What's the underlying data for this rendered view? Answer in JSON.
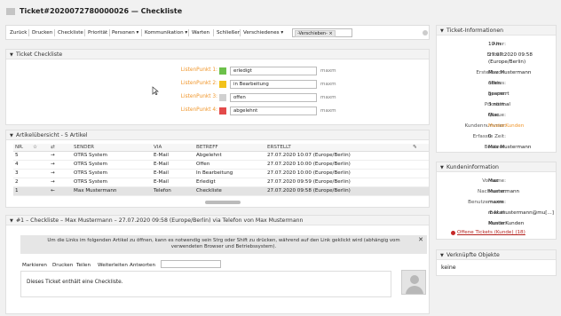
{
  "window": {
    "title": "Ticket#2020072780000026 — Checkliste"
  },
  "actions": {
    "items": [
      "Zurück",
      "Drucken",
      "Checkliste",
      "Priorität",
      "Personen ▾",
      "Kommunikation ▾",
      "Warten",
      "Schließen",
      "Verschiedenes ▾"
    ],
    "select_tag": "-Verschieben- ×"
  },
  "checklist": {
    "header": "Ticket Checkliste",
    "items": [
      {
        "label": "ListenPunkt 1:",
        "color": "#6cc04a",
        "status": "erledigt",
        "user": "maxm"
      },
      {
        "label": "ListenPunkt 2:",
        "color": "#f2c21b",
        "status": "in Bearbeitung",
        "user": "maxm"
      },
      {
        "label": "ListenPunkt 3:",
        "color": "#d0d0d0",
        "status": "offen",
        "user": "maxm"
      },
      {
        "label": "ListenPunkt 4:",
        "color": "#e34a4a",
        "status": "abgelehnt",
        "user": "maxm"
      }
    ]
  },
  "articles": {
    "header": "Artikelübersicht - 5 Artikel",
    "columns": [
      "NR.",
      "☆",
      "⇄",
      "SENDER",
      "VIA",
      "BETREFF",
      "ERSTELLT",
      "✎"
    ],
    "rows": [
      {
        "nr": "5",
        "dir": "→",
        "sender": "OTRS System",
        "via": "E-Mail",
        "subject": "Abgelehnt",
        "created": "27.07.2020 10:07 (Europe/Berlin)"
      },
      {
        "nr": "4",
        "dir": "→",
        "sender": "OTRS System",
        "via": "E-Mail",
        "subject": "Offen",
        "created": "27.07.2020 10:00 (Europe/Berlin)"
      },
      {
        "nr": "3",
        "dir": "→",
        "sender": "OTRS System",
        "via": "E-Mail",
        "subject": "In Bearbeitung",
        "created": "27.07.2020 10:00 (Europe/Berlin)"
      },
      {
        "nr": "2",
        "dir": "→",
        "sender": "OTRS System",
        "via": "E-Mail",
        "subject": "Erledigt",
        "created": "27.07.2020 09:59 (Europe/Berlin)"
      },
      {
        "nr": "1",
        "dir": "←",
        "sender": "Max Mustermann",
        "via": "Telefon",
        "subject": "Checkliste",
        "created": "27.07.2020 09:58 (Europe/Berlin)"
      }
    ]
  },
  "article": {
    "header": "#1 – Checkliste – Max Mustermann – 27.07.2020 09:58 (Europe/Berlin) via Telefon von Max Mustermann",
    "notice": "Um die Links im folgenden Artikel zu öffnen, kann es notwendig sein Strg oder Shift zu drücken, während auf den Link geklickt wird (abhängig vom verwendeten Browser und Betriebssystem).",
    "actions": [
      "Markieren",
      "Drucken",
      "Teilen",
      "Weiterleiten",
      "Antworten"
    ],
    "body": "Dieses Ticket enthält eine Checkliste."
  },
  "ticket_info": {
    "header": "Ticket-Informationen",
    "fields": [
      {
        "k": "Alter:",
        "v": "10 m"
      },
      {
        "k": "Erstellt:",
        "v": "27.07.2020 09:58"
      },
      {
        "k": "",
        "v": "(Europe/Berlin)"
      },
      {
        "k": "Erstellt von:",
        "v": "Max Mustermann"
      },
      {
        "k": "Status:",
        "v": "offen"
      },
      {
        "k": "Sperre:",
        "v": "gesperrt"
      },
      {
        "k": "Priorität:",
        "v": "3 normal"
      },
      {
        "k": "Queue:",
        "v": "Misc"
      },
      {
        "k": "Kundennummer:",
        "v": "MusterKunden"
      },
      {
        "k": "Erfasste Zeit:",
        "v": "0"
      },
      {
        "k": "Besitzer:",
        "v": "Max Mustermann"
      }
    ]
  },
  "customer_info": {
    "header": "Kundeninformation",
    "fields": [
      {
        "k": "Vorname:",
        "v": "Max"
      },
      {
        "k": "Nachname:",
        "v": "Mustermann"
      },
      {
        "k": "Benutzername:",
        "v": "maxm"
      },
      {
        "k": "E-Mail:",
        "v": "max.mustermann@mu[...]"
      },
      {
        "k": "Kunde:",
        "v": "MusterKunden"
      }
    ],
    "open_tickets": "Offene Tickets (Kunde) (18)"
  },
  "linked": {
    "header": "Verknüpfte Objekte",
    "value": "keine"
  }
}
